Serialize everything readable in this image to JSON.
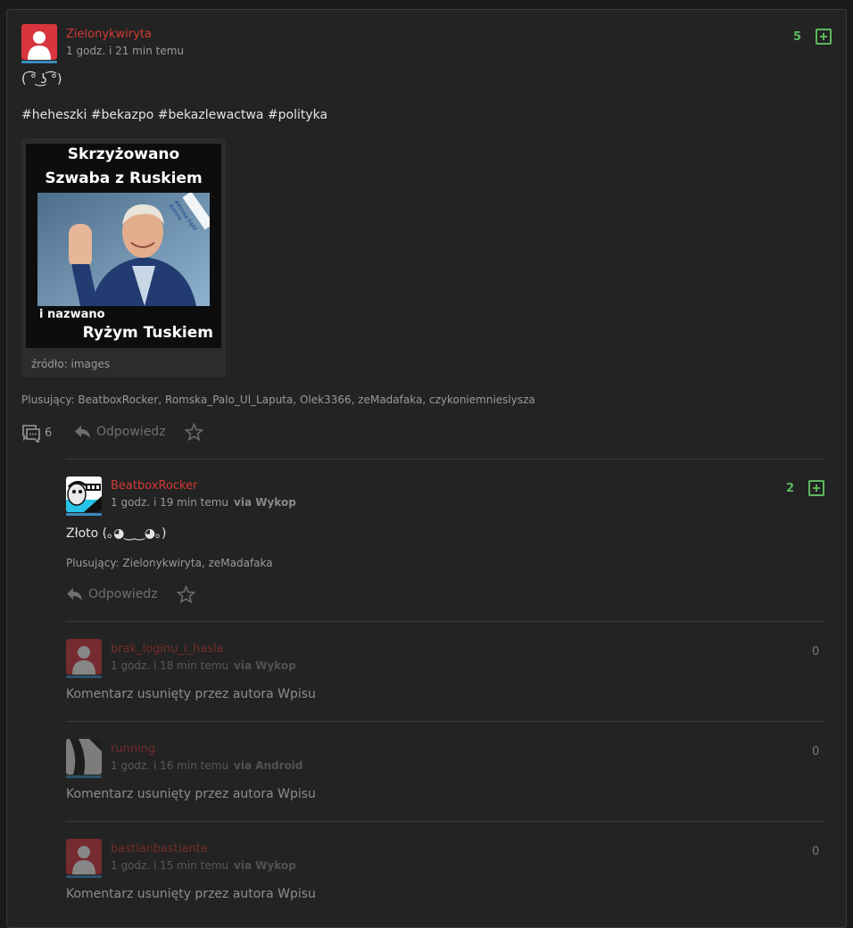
{
  "post": {
    "author": "Zielonykwiryta",
    "time": "1 godz. i 21 min temu",
    "votes": "5",
    "text_line1": "( ͡° ͜ʖ ͡°)",
    "tags": "#heheszki #bekazpo #bekazlewactwa #polityka",
    "image": {
      "caption_top1": "Skrzyżowano",
      "caption_top2": "Szwaba z Ruskiem",
      "caption_bottom1": "i nazwano",
      "caption_bottom2": "Ryżym Tuskiem",
      "stamp": "#Polska bądź dumna"
    },
    "source_label": "źródło: images",
    "plusers_label": "Plusujący:",
    "plusers": [
      "BeatboxRocker",
      "Romska_Palo_Ul_Laputa",
      "Olek3366",
      "zeMadafaka",
      "czykoniemnieslysza"
    ],
    "comments_count": "6",
    "reply_label": "Odpowiedz"
  },
  "comments": [
    {
      "author": "BeatboxRocker",
      "time": "1 godz. i 19 min temu",
      "via": "via Wykop",
      "votes": "2",
      "text": "Złoto (｡◕‿‿◕｡)",
      "plusers_label": "Plusujący:",
      "plusers": [
        "Zielonykwiryta",
        "zeMadafaka"
      ],
      "reply_label": "Odpowiedz"
    },
    {
      "author": "brak_loginu_i_hasla",
      "time": "1 godz. i 18 min temu",
      "via": "via Wykop",
      "votes": "0",
      "text": "Komentarz usunięty przez autora Wpisu"
    },
    {
      "author": "running",
      "time": "1 godz. i 16 min temu",
      "via": "via Android",
      "votes": "0",
      "text": "Komentarz usunięty przez autora Wpisu"
    },
    {
      "author": "bastianbastiante",
      "time": "1 godz. i 15 min temu",
      "via": "via Wykop",
      "votes": "0",
      "text": "Komentarz usunięty przez autora Wpisu"
    }
  ],
  "colors": {
    "background": "#1b1b1b",
    "card": "#232323",
    "username": "#d23a35",
    "vote_green": "#5cb85c",
    "underline_blue": "#3a8bbf"
  }
}
